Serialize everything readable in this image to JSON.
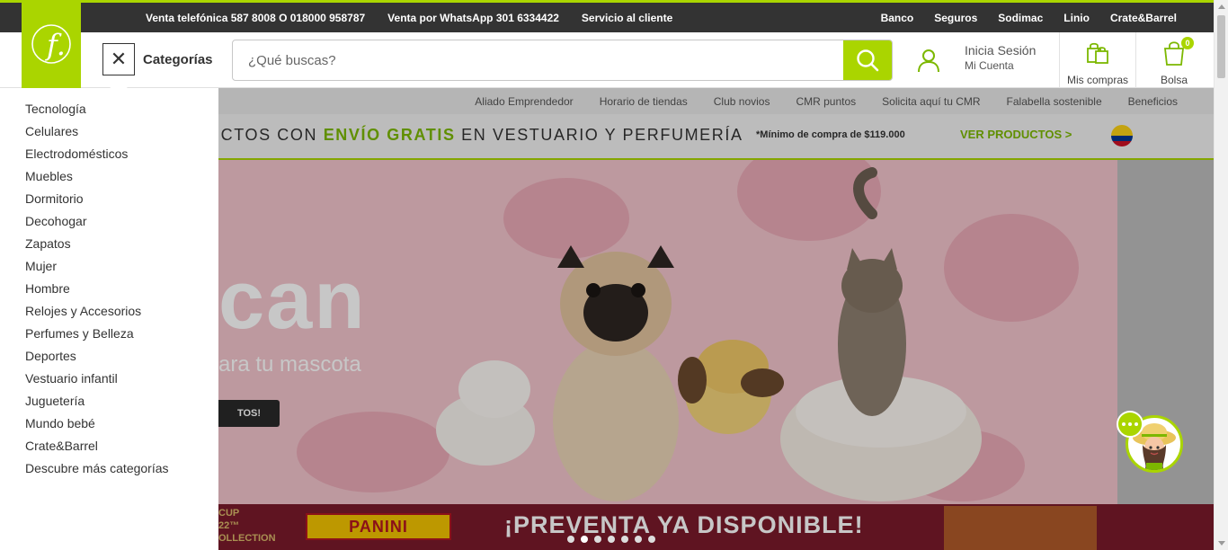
{
  "topbar": {
    "left_links": [
      "Venta telefónica 587 8008 O 018000 958787",
      "Venta por WhatsApp 301 6334422",
      "Servicio al cliente"
    ],
    "right_links": [
      "Banco",
      "Seguros",
      "Sodimac",
      "Linio",
      "Crate&Barrel"
    ]
  },
  "logo": {
    "glyph": "f."
  },
  "header": {
    "categories_close": "✕",
    "categories_label": "Categorías",
    "search_placeholder": "¿Qué buscas?",
    "login_title": "Inicia Sesión",
    "login_subtitle": "Mi Cuenta",
    "purchases_label": "Mis compras",
    "bag_label": "Bolsa",
    "bag_count": "0"
  },
  "subnav": {
    "links": [
      "Aliado Emprendedor",
      "Horario de tiendas",
      "Club novios",
      "CMR puntos",
      "Solicita aquí tu CMR",
      "Falabella sostenible",
      "Beneficios"
    ]
  },
  "promo": {
    "text_pre": "UCTOS CON ",
    "text_highlight": "ENVÍO GRATIS",
    "text_post": " EN VESTUARIO Y PERFUMERÍA",
    "minimum": "*Mínimo de compra de $119.000",
    "cta": "VER PRODUCTOS >"
  },
  "hero": {
    "word": "can",
    "subtitle": "ara tu mascota",
    "button": "TOS!"
  },
  "bottom_banner": {
    "cup_text": "CUP",
    "cup_year": "22™",
    "collection": "OLLECTION",
    "brand": "PANINI",
    "headline": "¡PREVENTA YA DISPONIBLE!"
  },
  "carousel": {
    "dots": 7,
    "active_index": 1
  },
  "categories": [
    "Tecnología",
    "Celulares",
    "Electrodomésticos",
    "Muebles",
    "Dormitorio",
    "Decohogar",
    "Zapatos",
    "Mujer",
    "Hombre",
    "Relojes y Accesorios",
    "Perfumes y Belleza",
    "Deportes",
    "Vestuario infantil",
    "Juguetería",
    "Mundo bebé",
    "Crate&Barrel",
    "Descubre más categorías"
  ],
  "icons": {
    "search": "search-icon",
    "user": "user-icon",
    "purchases": "shopping-bags-icon",
    "bag": "bag-icon",
    "flag": "colombia-flag-icon",
    "chat": "chat-assistant-icon"
  },
  "colors": {
    "brand_green": "#aad500",
    "dark_bar": "#333333",
    "promo_green": "#7cb800"
  }
}
